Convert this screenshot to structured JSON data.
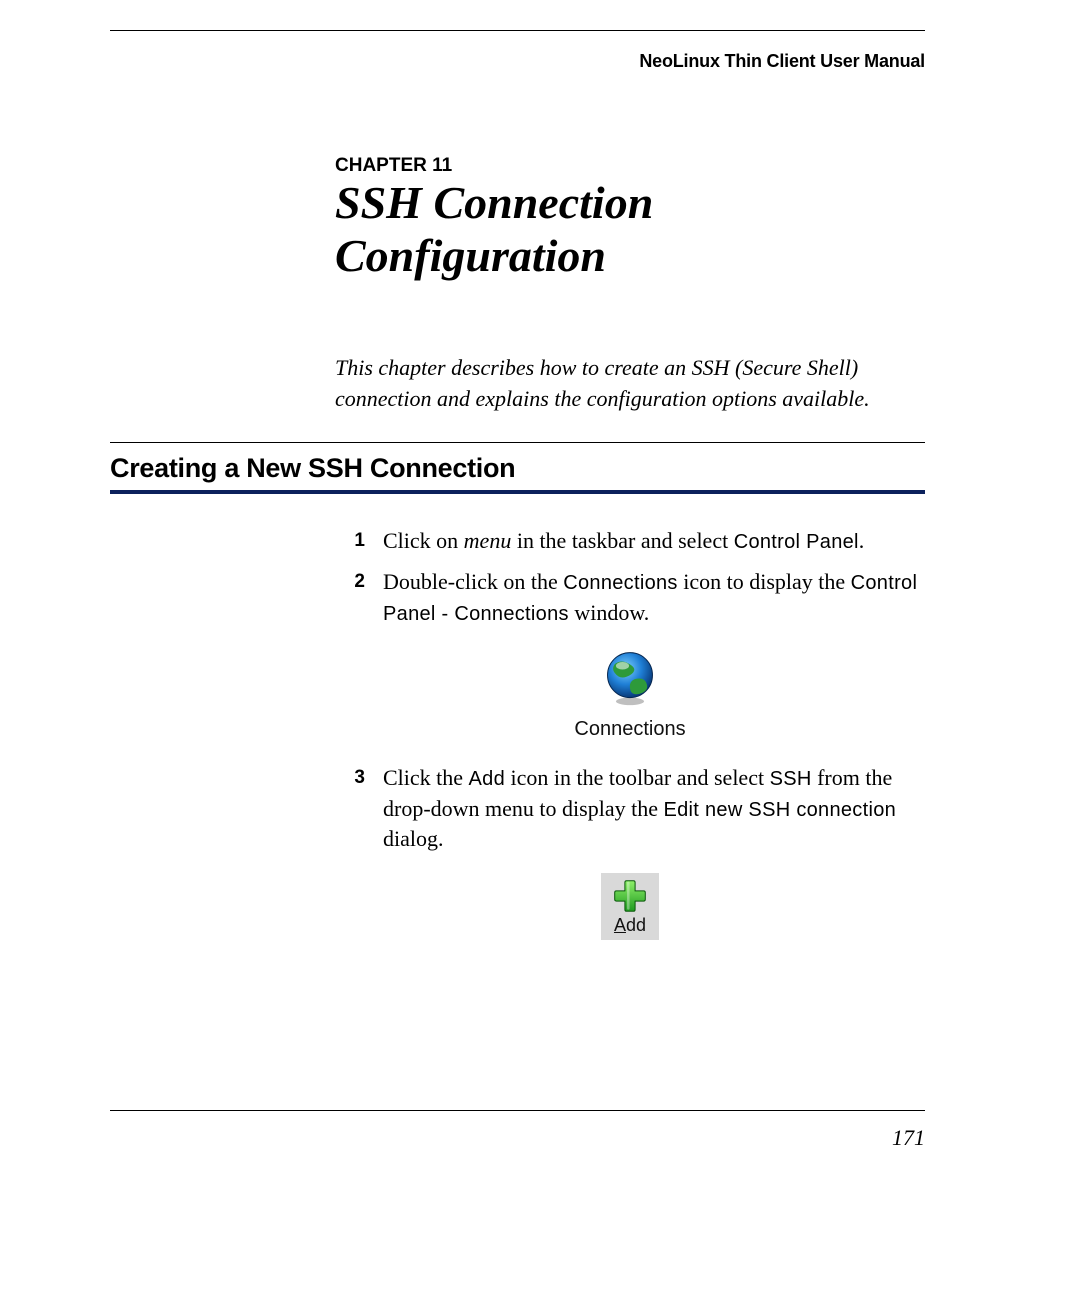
{
  "running_head": "NeoLinux Thin Client User Manual",
  "chapter_label": "CHAPTER 11",
  "chapter_title": "SSH Connection Configuration",
  "intro": "This chapter describes how to create an SSH (Secure Shell) connection and explains the configuration options available.",
  "section_head": "Creating a New SSH Connection",
  "steps": {
    "s1": {
      "num": "1",
      "t1": "Click on ",
      "menu": "menu",
      "t2": " in the taskbar and select ",
      "cp": "Control Panel",
      "t3": "."
    },
    "s2": {
      "num": "2",
      "t1": "Double-click on the ",
      "conn": "Connections",
      "t2": " icon to display the ",
      "win": "Control Panel - Connections",
      "t3": " window."
    },
    "s3": {
      "num": "3",
      "t1": "Click the ",
      "add": "Add",
      "t2": " icon in the toolbar and select ",
      "ssh": "SSH",
      "t3": " from the drop-down menu to display the ",
      "dlg": "Edit new SSH connection",
      "t4": " dialog."
    }
  },
  "fig_conn_label": "Connections",
  "fig_add_first": "A",
  "fig_add_rest": "dd",
  "page_number": "171"
}
